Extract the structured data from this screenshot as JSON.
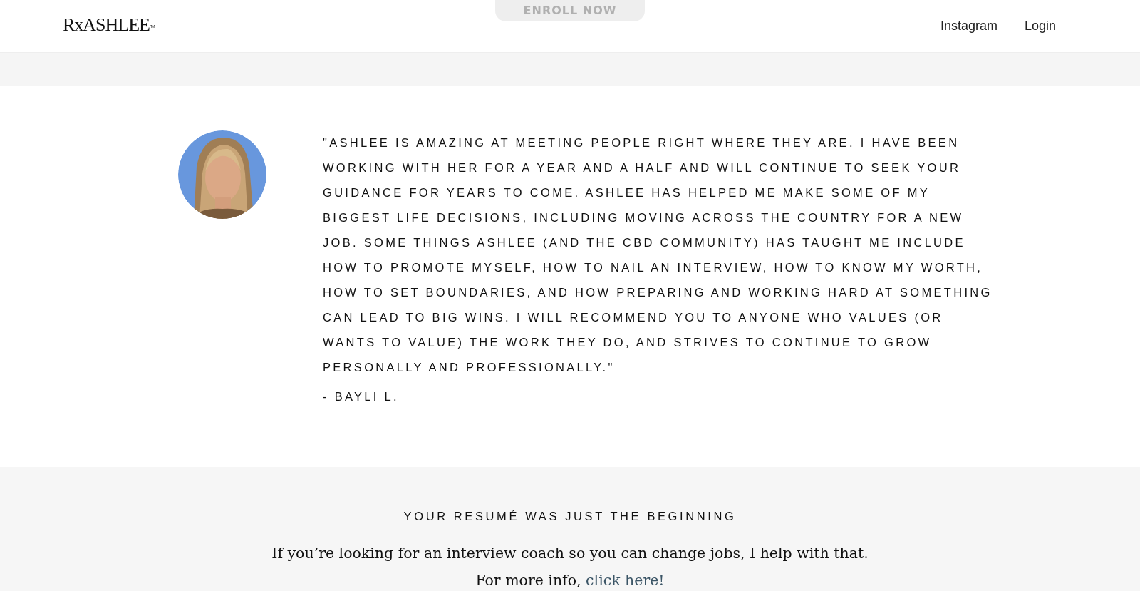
{
  "header": {
    "logo": {
      "text": "RxASHLEE",
      "mark": "TM"
    },
    "nav": [
      "Instagram",
      "Login"
    ],
    "hidden_button": "ENROLL NOW"
  },
  "testimonial": {
    "quote": "\"ASHLEE IS AMAZING AT MEETING PEOPLE RIGHT WHERE THEY ARE. I HAVE BEEN WORKING WITH HER FOR A YEAR AND A HALF AND WILL CONTINUE TO SEEK YOUR GUIDANCE FOR YEARS TO COME. ASHLEE HAS HELPED ME MAKE SOME OF MY BIGGEST LIFE DECISIONS, INCLUDING MOVING ACROSS THE COUNTRY FOR A NEW JOB. SOME THINGS ASHLEE (AND THE CBD COMMUNITY) HAS TAUGHT ME INCLUDE HOW TO PROMOTE MYSELF, HOW TO NAIL AN INTERVIEW, HOW TO KNOW MY WORTH, HOW TO SET BOUNDARIES, AND HOW PREPARING AND WORKING HARD AT SOMETHING CAN LEAD TO BIG WINS. I WILL RECOMMEND YOU TO ANYONE WHO VALUES (OR WANTS TO VALUE) THE WORK THEY DO, AND STRIVES TO CONTINUE TO GROW PERSONALLY AND PROFESSIONALLY.\"",
    "author": "- BAYLI L."
  },
  "cta": {
    "heading": "YOUR RESUMÉ WAS JUST THE BEGINNING",
    "text": "If you’re looking for an interview coach so you can change jobs, I help with that.",
    "more": {
      "text": "For more info,",
      "link": "click here!"
    }
  }
}
